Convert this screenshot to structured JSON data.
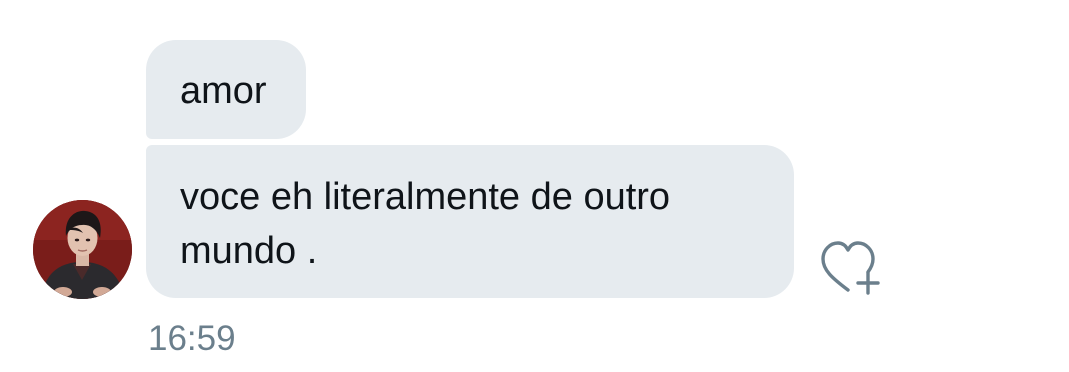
{
  "conversation": {
    "messages": [
      {
        "text": "amor"
      },
      {
        "text": "voce eh literalmente de outro mundo ."
      }
    ],
    "timestamp": "16:59",
    "reaction_button_icon": "heart-plus-icon",
    "avatar": "avatar-photo"
  },
  "colors": {
    "bubble_background": "#e6ebef",
    "message_text": "#0f1419",
    "timestamp_text": "#6b7f8c",
    "icon_stroke": "#6b7f8c"
  }
}
